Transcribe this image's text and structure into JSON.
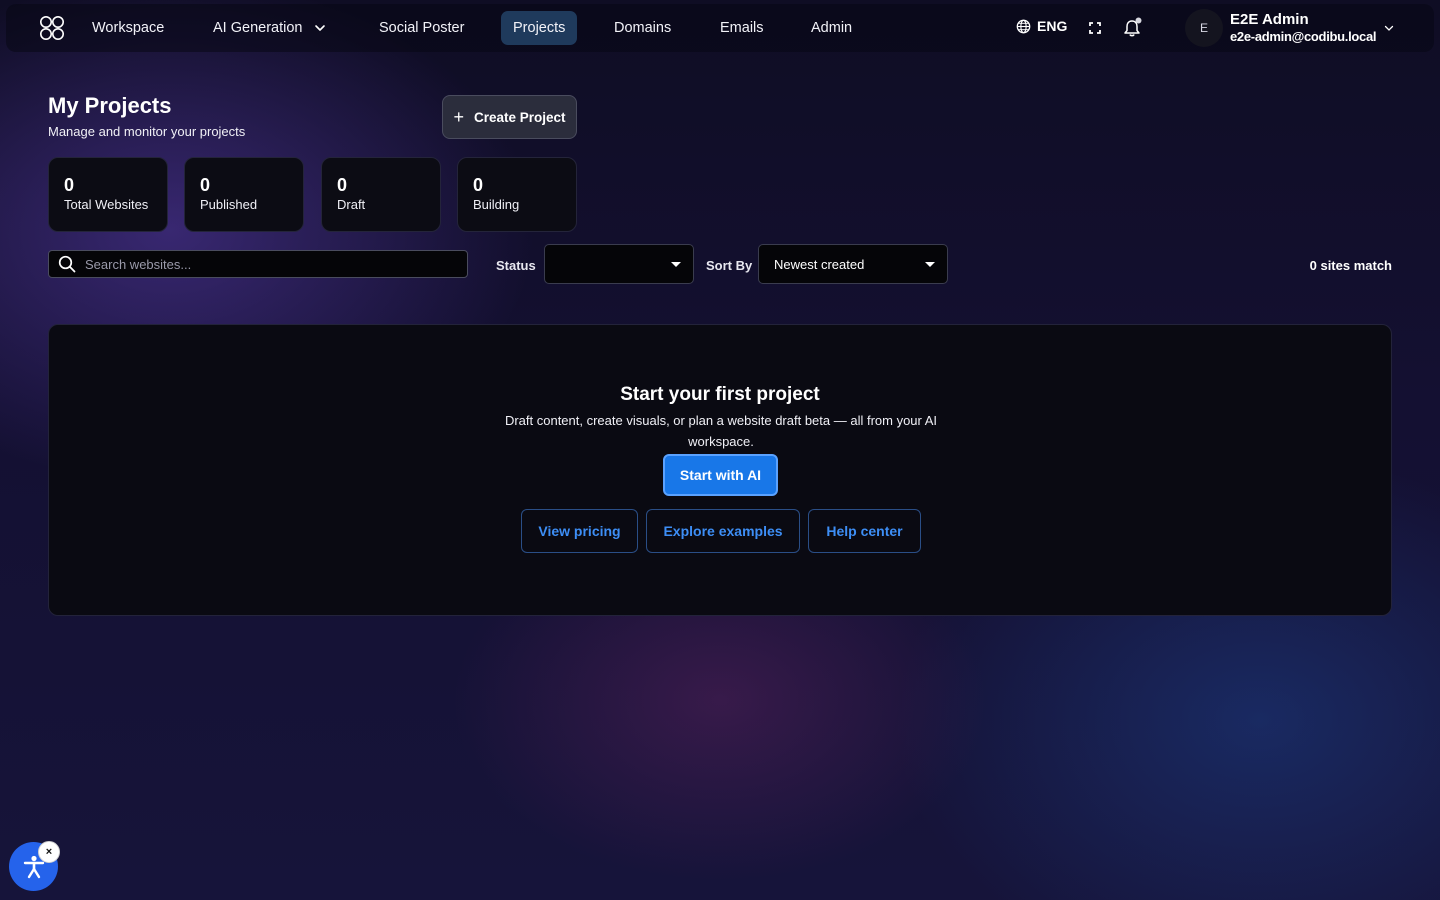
{
  "nav": {
    "items": [
      {
        "label": "Workspace"
      },
      {
        "label": "AI Generation"
      },
      {
        "label": "Social Poster"
      },
      {
        "label": "Projects"
      },
      {
        "label": "Domains"
      },
      {
        "label": "Emails"
      },
      {
        "label": "Admin"
      }
    ],
    "active": "Projects",
    "language": "ENG",
    "user": {
      "initial": "E",
      "name": "E2E Admin",
      "email": "e2e-admin@codibu.local"
    }
  },
  "header": {
    "title": "My Projects",
    "subtitle": "Manage and monitor your projects",
    "create_label": "Create Project"
  },
  "stats": [
    {
      "value": "0",
      "label": "Total Websites"
    },
    {
      "value": "0",
      "label": "Published"
    },
    {
      "value": "0",
      "label": "Draft"
    },
    {
      "value": "0",
      "label": "Building"
    }
  ],
  "filters": {
    "search_placeholder": "Search websites...",
    "status_label": "Status",
    "status_value": "",
    "sort_label": "Sort By",
    "sort_value": "Newest created",
    "match_text": "0 sites match"
  },
  "empty_state": {
    "title": "Start your first project",
    "description": "Draft content, create visuals, or plan a website draft beta — all from your AI workspace.",
    "primary_label": "Start with AI",
    "links": [
      {
        "label": "View pricing"
      },
      {
        "label": "Explore examples"
      },
      {
        "label": "Help center"
      }
    ]
  },
  "accessibility": {
    "icon": "accessibility-icon",
    "close_glyph": "×"
  },
  "colors": {
    "accent": "#1877e8",
    "link": "#3d8ef5",
    "nav_active_bg": "#1f3a5c"
  }
}
